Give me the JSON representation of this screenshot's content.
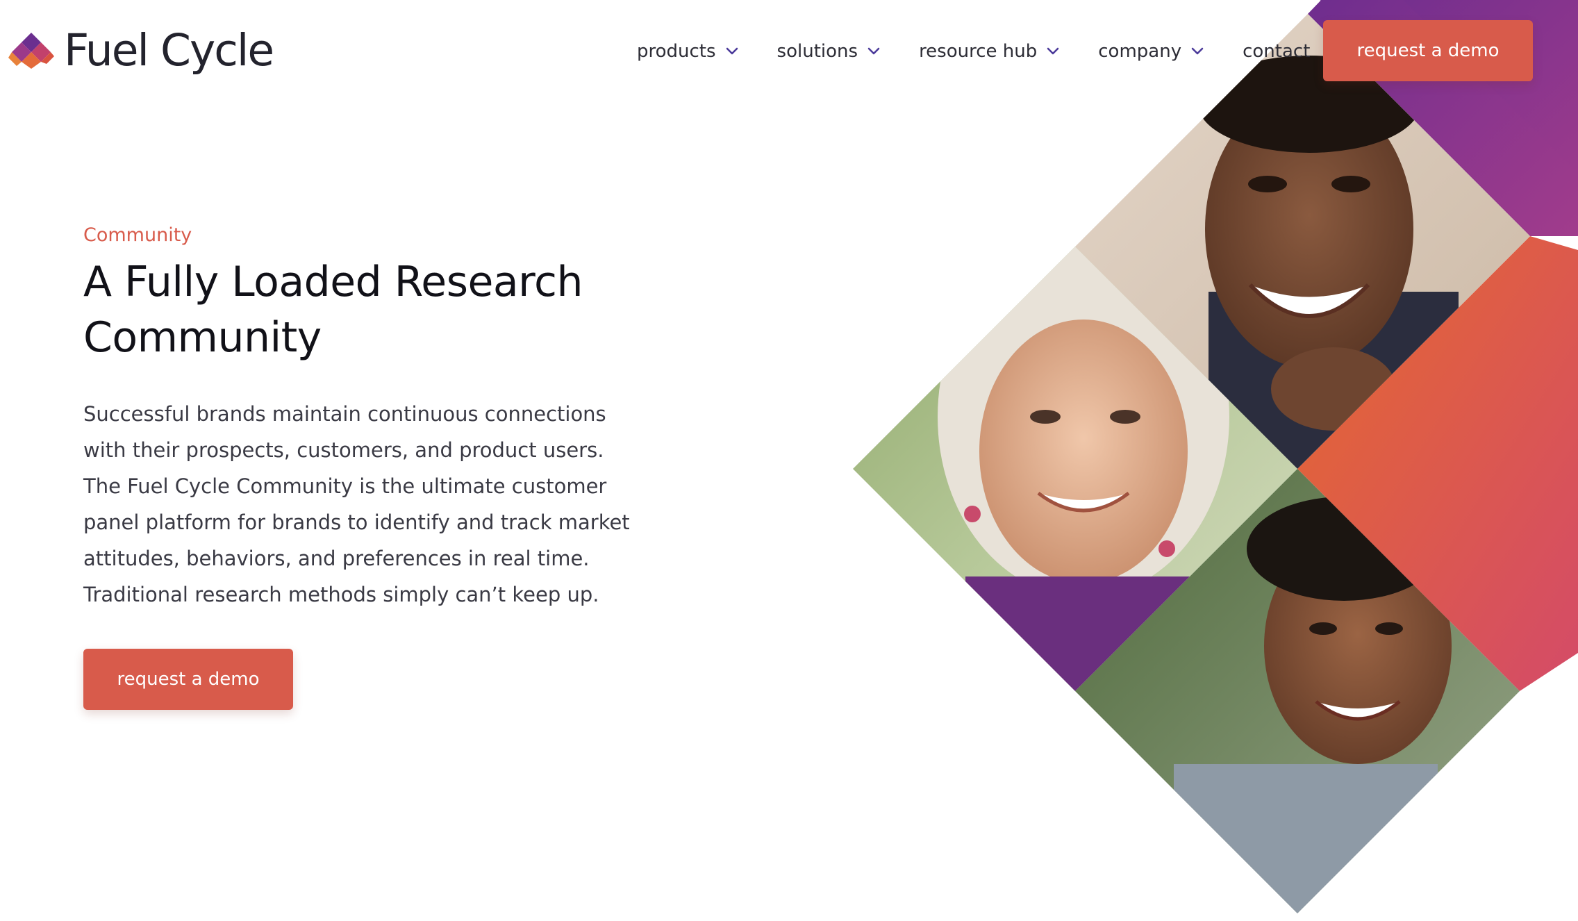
{
  "header": {
    "brand_name": "Fuel Cycle",
    "nav": [
      {
        "label": "products",
        "has_dropdown": true
      },
      {
        "label": "solutions",
        "has_dropdown": true
      },
      {
        "label": "resource hub",
        "has_dropdown": true
      },
      {
        "label": "company",
        "has_dropdown": true
      },
      {
        "label": "contact",
        "has_dropdown": false
      }
    ],
    "cta_label": "request a demo"
  },
  "hero": {
    "eyebrow": "Community",
    "headline": "A Fully Loaded Research Community",
    "body": "Successful brands maintain continuous connections with their prospects, customers, and product users. The Fuel Cycle Community is the ultimate customer panel platform for brands to identify and track market attitudes, behaviors, and preferences in real time. Traditional research methods simply can’t keep up.",
    "cta_label": "request a demo"
  },
  "colors": {
    "accent": "#d85b4b",
    "purple": "#7b3595",
    "orange": "#e2663a",
    "text_dark": "#111118"
  },
  "icons": {
    "logo": "diamond-logo-icon",
    "dropdown": "chevron-down-icon"
  }
}
